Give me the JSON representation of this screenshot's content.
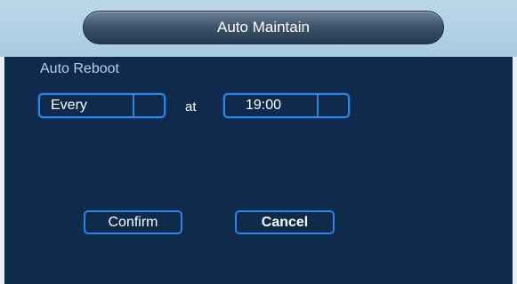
{
  "dialog": {
    "title": "Auto Maintain"
  },
  "auto_reboot": {
    "section_label": "Auto Reboot",
    "frequency": "Every",
    "at_label": "at",
    "time": "19:00"
  },
  "buttons": {
    "confirm": "Confirm",
    "cancel": "Cancel"
  },
  "colors": {
    "background": "#0f2a4d",
    "accent_border": "#2f84e6",
    "header": "#a9cbe2",
    "label_text": "#b8cfe6"
  }
}
